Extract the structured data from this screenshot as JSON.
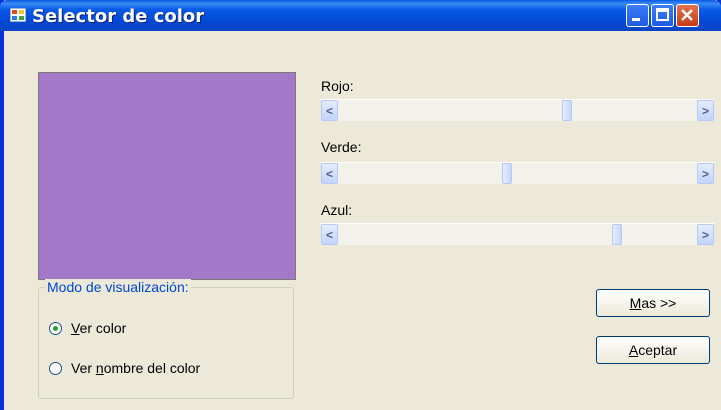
{
  "window": {
    "title": "Selector de color"
  },
  "preview": {
    "color": "#a478c8"
  },
  "display_mode": {
    "legend": "Modo de visualización:",
    "options": [
      {
        "label_mnemonic": "V",
        "label_rest": "er color",
        "selected": true
      },
      {
        "label_before": "Ver ",
        "label_mnemonic": "n",
        "label_rest": "ombre del color",
        "selected": false
      }
    ]
  },
  "sliders": [
    {
      "label": "Rojo:",
      "value": 164
    },
    {
      "label": "Verde:",
      "value": 120
    },
    {
      "label": "Azul:",
      "value": 200
    }
  ],
  "buttons": {
    "more": {
      "mnemonic": "M",
      "rest": "as >>"
    },
    "accept": {
      "mnemonic": "A",
      "rest": "ceptar"
    }
  },
  "icons": {
    "left": "scroll-left-arrow-icon",
    "right": "scroll-right-arrow-icon"
  }
}
